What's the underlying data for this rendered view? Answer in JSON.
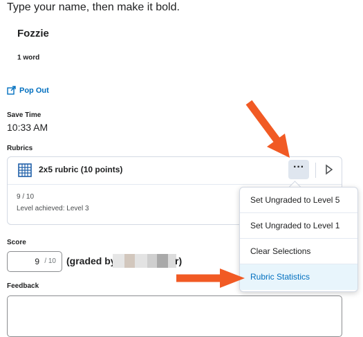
{
  "instruction": "Type your name, then make it bold.",
  "answer": "Fozzie",
  "word_count": "1 word",
  "pop_out_label": "Pop Out",
  "save_time": {
    "label": "Save Time",
    "value": "10:33 AM"
  },
  "rubrics": {
    "label": "Rubrics",
    "title": "2x5 rubric (10 points)",
    "more_label": "···",
    "score": "9 / 10",
    "level": "Level achieved: Level 3"
  },
  "score": {
    "label": "Score",
    "value": "9",
    "denominator": "/ 10",
    "graded_by": "(graded by",
    "graded_by_end": "r)"
  },
  "feedback_label": "Feedback",
  "menu": {
    "items": [
      {
        "label": "Set Ungraded to Level 5"
      },
      {
        "label": "Set Ungraded to Level 1"
      },
      {
        "label": "Clear Selections"
      },
      {
        "label": "Rubric Statistics"
      }
    ]
  },
  "colors": {
    "accent": "#006fbf",
    "arrow": "#f15a24",
    "menu_highlight": "#e8f5fc"
  },
  "icons": [
    "pop-out-icon",
    "rubric-grid-icon",
    "more-options-icon",
    "play-icon"
  ]
}
